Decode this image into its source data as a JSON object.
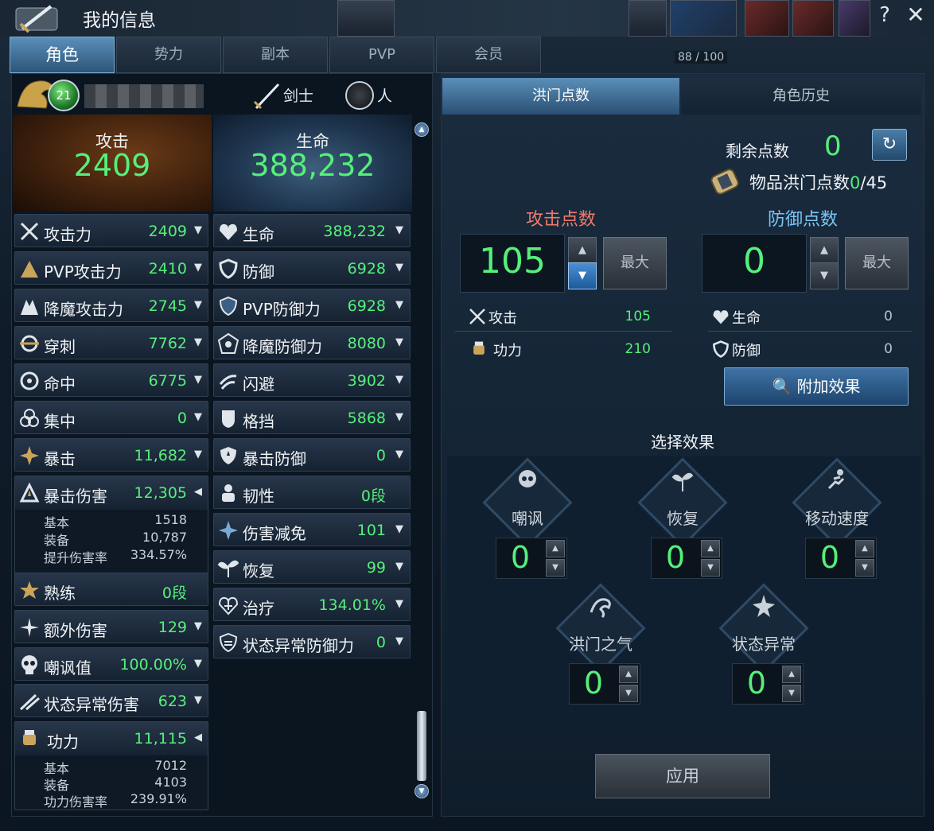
{
  "window": {
    "title": "我的信息",
    "help": "?",
    "close": "✕",
    "hud_count": "88 / 100"
  },
  "tabs": [
    {
      "label": "角色"
    },
    {
      "label": "势力"
    },
    {
      "label": "副本"
    },
    {
      "label": "PVP"
    },
    {
      "label": "会员"
    }
  ],
  "character": {
    "level": "21",
    "class": "剑士",
    "race": "人"
  },
  "attack_box": {
    "label": "攻击",
    "value": "2409"
  },
  "hp_box": {
    "label": "生命",
    "value": "388,232"
  },
  "left_stats": [
    {
      "label": "攻击力",
      "value": "2409",
      "icon": "crossed-swords-icon"
    },
    {
      "label": "PVP攻击力",
      "value": "2410",
      "icon": "pvp-attack-icon"
    },
    {
      "label": "降魔攻击力",
      "value": "2745",
      "icon": "demon-attack-icon"
    },
    {
      "label": "穿刺",
      "value": "7762",
      "icon": "pierce-icon"
    },
    {
      "label": "命中",
      "value": "6775",
      "icon": "accuracy-icon"
    },
    {
      "label": "集中",
      "value": "0",
      "icon": "focus-icon"
    },
    {
      "label": "暴击",
      "value": "11,682",
      "icon": "critical-icon"
    },
    {
      "label": "暴击伤害",
      "value": "12,305",
      "icon": "critical-damage-icon"
    },
    {
      "label": "熟练",
      "value": "0段",
      "icon": "mastery-icon"
    },
    {
      "label": "额外伤害",
      "value": "129",
      "icon": "extra-damage-icon"
    },
    {
      "label": "嘲讽值",
      "value": "100.00%",
      "icon": "taunt-skull-icon"
    },
    {
      "label": "状态异常伤害",
      "value": "623",
      "icon": "status-damage-icon"
    },
    {
      "label": "功力",
      "value": "11,115",
      "icon": "power-fist-icon"
    }
  ],
  "crit_damage_sub": [
    {
      "label": "基本",
      "value": "1518"
    },
    {
      "label": "装备",
      "value": "10,787"
    },
    {
      "label": "提升伤害率",
      "value": "334.57%"
    }
  ],
  "power_sub": [
    {
      "label": "基本",
      "value": "7012"
    },
    {
      "label": "装备",
      "value": "4103"
    },
    {
      "label": "功力伤害率",
      "value": "239.91%"
    }
  ],
  "right_stats": [
    {
      "label": "生命",
      "value": "388,232",
      "icon": "heart-icon"
    },
    {
      "label": "防御",
      "value": "6928",
      "icon": "shield-icon"
    },
    {
      "label": "PVP防御力",
      "value": "6928",
      "icon": "pvp-defense-icon"
    },
    {
      "label": "降魔防御力",
      "value": "8080",
      "icon": "demon-defense-icon"
    },
    {
      "label": "闪避",
      "value": "3902",
      "icon": "evasion-icon"
    },
    {
      "label": "格挡",
      "value": "5868",
      "icon": "block-icon"
    },
    {
      "label": "暴击防御",
      "value": "0",
      "icon": "critical-defense-icon"
    },
    {
      "label": "韧性",
      "value": "0段",
      "icon": "toughness-icon"
    },
    {
      "label": "伤害减免",
      "value": "101",
      "icon": "damage-reduction-icon"
    },
    {
      "label": "恢复",
      "value": "99",
      "icon": "regen-sprout-icon"
    },
    {
      "label": "治疗",
      "value": "134.01%",
      "icon": "heal-icon"
    },
    {
      "label": "状态异常防御力",
      "value": "0",
      "icon": "status-defense-icon"
    }
  ],
  "right_tabs": {
    "active": "洪门点数",
    "inactive": "角色历史"
  },
  "points": {
    "remaining_label": "剩余点数",
    "remaining_value": "0",
    "item_label": "物品洪门点数",
    "item_current": "0",
    "item_max": "/45",
    "attack_header": "攻击点数",
    "attack_value": "105",
    "defense_header": "防御点数",
    "defense_value": "0",
    "max_label": "最大"
  },
  "effects": {
    "attack": {
      "label": "攻击",
      "value": "105"
    },
    "power": {
      "label": "功力",
      "value": "210"
    },
    "hp": {
      "label": "生命",
      "value": "0"
    },
    "defense": {
      "label": "防御",
      "value": "0"
    },
    "addfx_label": "附加效果"
  },
  "select": {
    "title": "选择效果",
    "items": [
      {
        "label": "嘲讽",
        "value": "0"
      },
      {
        "label": "恢复",
        "value": "0"
      },
      {
        "label": "移动速度",
        "value": "0"
      },
      {
        "label": "洪门之气",
        "value": "0"
      },
      {
        "label": "状态异常",
        "value": "0"
      }
    ]
  },
  "apply_label": "应用",
  "colors": {
    "value_green": "#55f07a",
    "attack_red": "#f07a6a",
    "defense_blue": "#7ac5f5",
    "tab_active": "#5a8fb9"
  }
}
